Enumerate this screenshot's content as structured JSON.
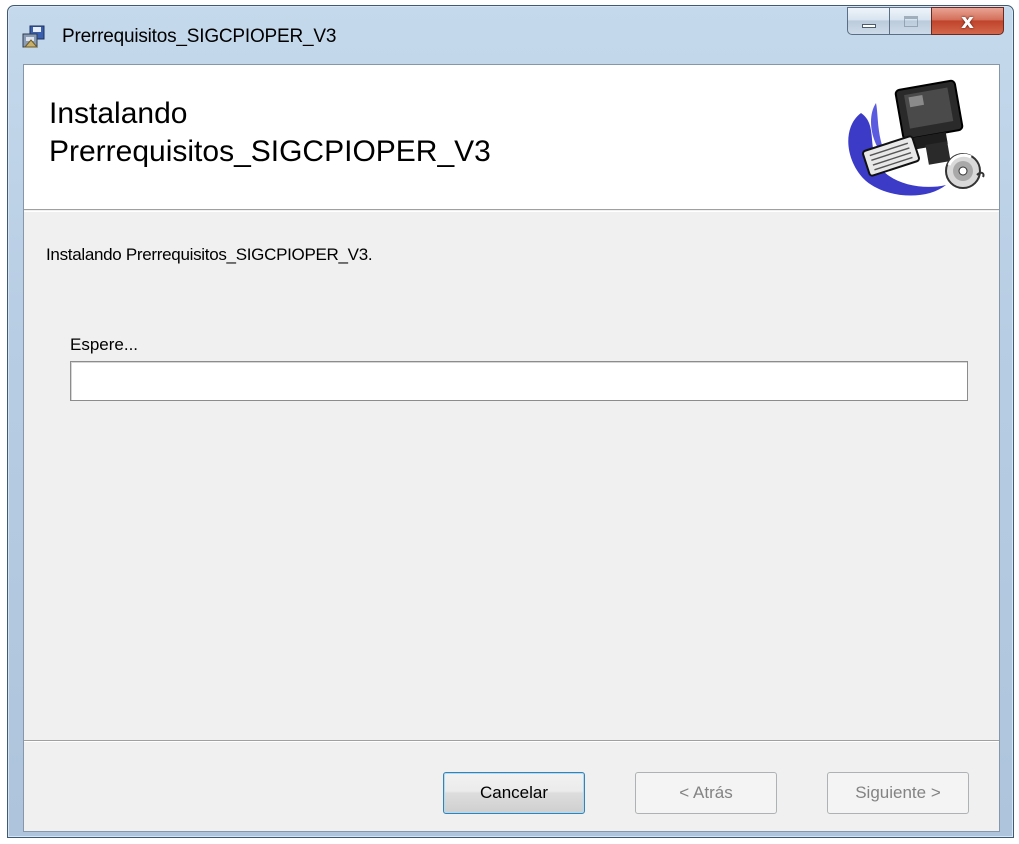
{
  "window": {
    "title": "Prerrequisitos_SIGCPIOPER_V3",
    "app_icon": "installer-icon",
    "controls": {
      "minimize_icon": "minimize-icon",
      "maximize_icon": "maximize-icon",
      "close_icon": "close-icon",
      "close_glyph": "x"
    }
  },
  "banner": {
    "title_line1": "Instalando",
    "title_line2": "Prerrequisitos_SIGCPIOPER_V3",
    "graphic": "computer-setup-icon"
  },
  "body": {
    "description": "Instalando Prerrequisitos_SIGCPIOPER_V3.",
    "wait_label": "Espere...",
    "progress": 0
  },
  "footer": {
    "cancel_label": "Cancelar",
    "back_label": "< Atrás",
    "next_label": "Siguiente >"
  },
  "colors": {
    "titlebar": "#b9cfe5",
    "client_bg": "#f0f0f0",
    "close_button": "#c7503a",
    "progress_fill": "#22b14c"
  }
}
